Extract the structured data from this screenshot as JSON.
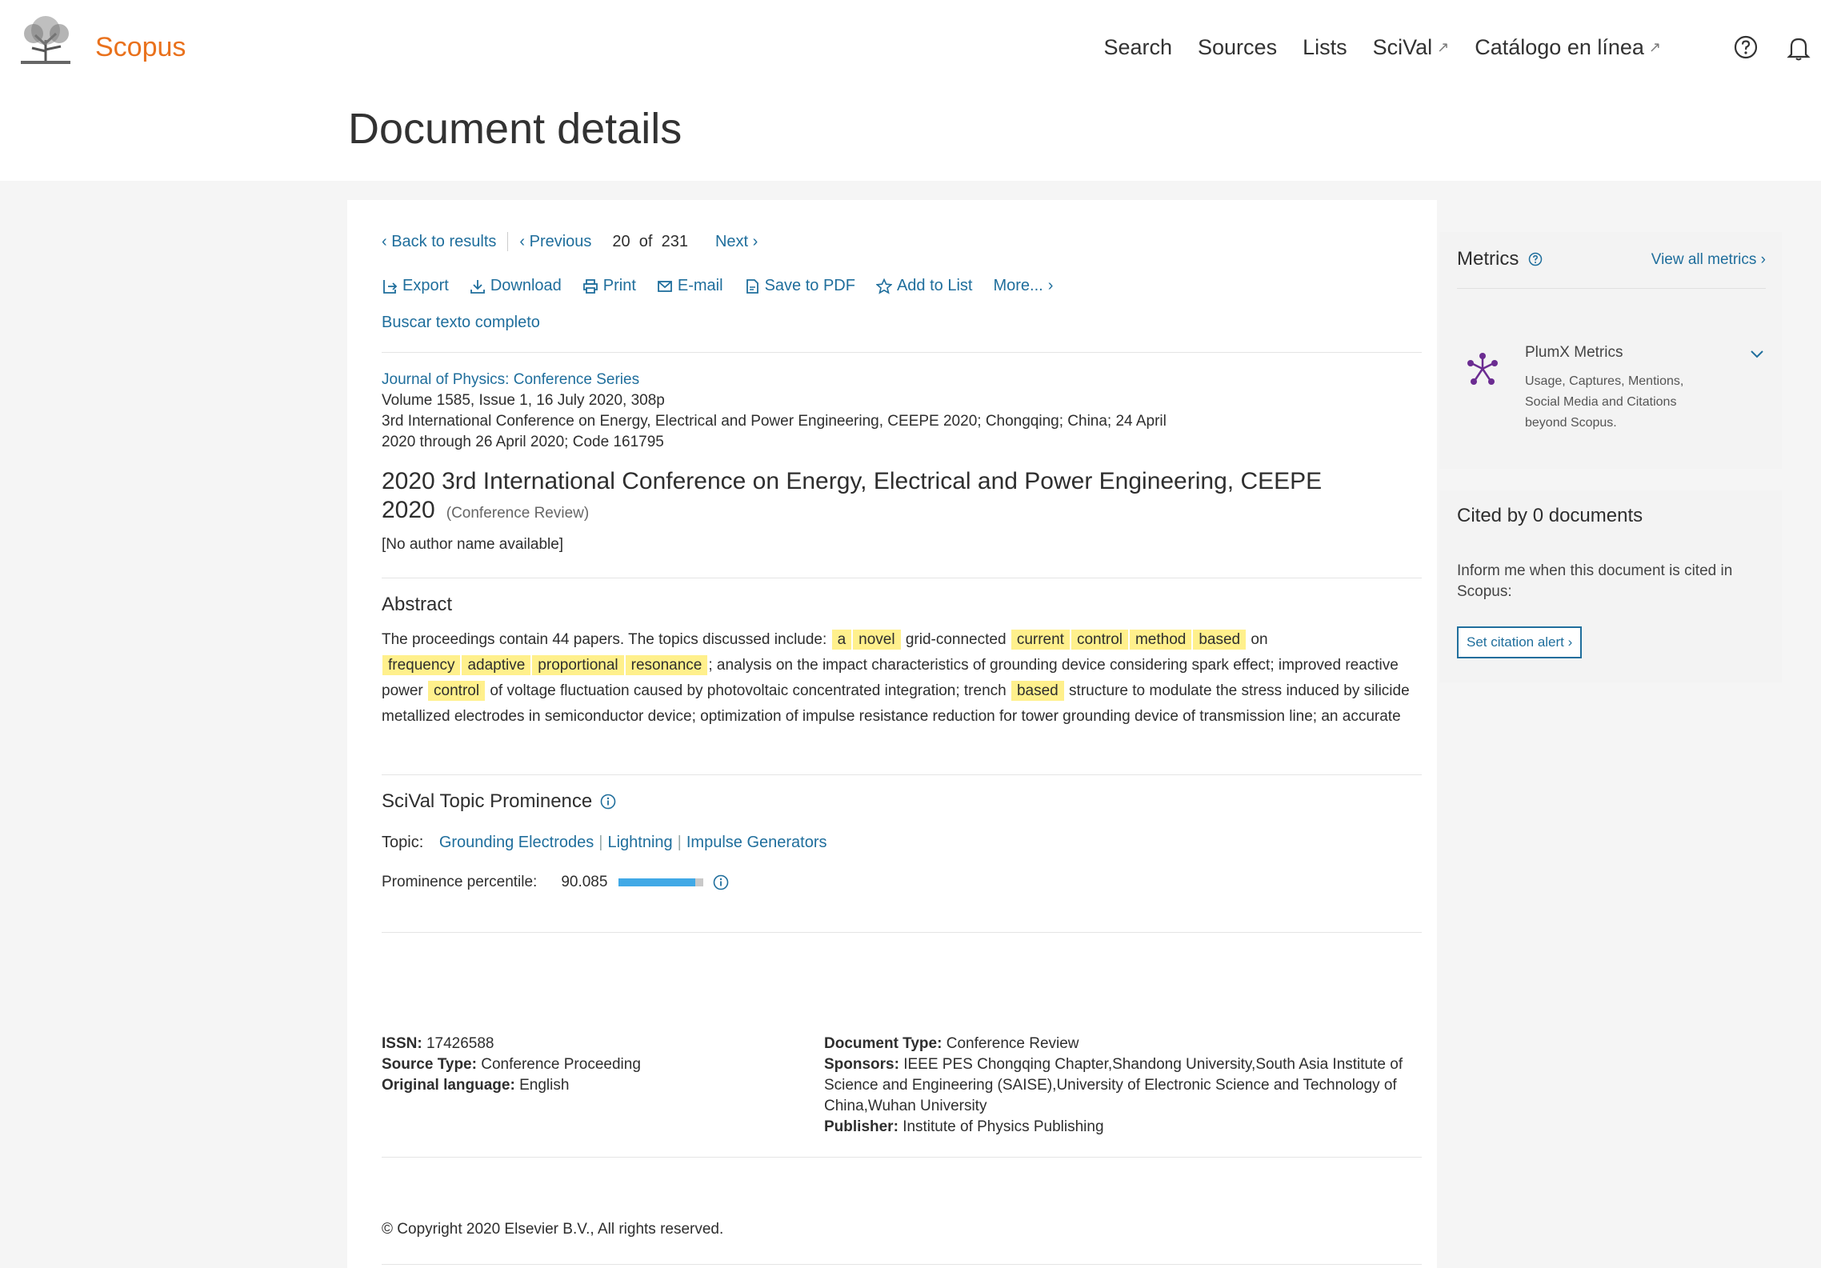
{
  "header": {
    "brand": "Scopus",
    "nav": [
      {
        "label": "Search",
        "ext": ""
      },
      {
        "label": "Sources",
        "ext": ""
      },
      {
        "label": "Lists",
        "ext": ""
      },
      {
        "label": "SciVal",
        "ext": "↗"
      },
      {
        "label": "Catálogo en línea",
        "ext": "↗"
      }
    ],
    "icons": [
      "help-icon",
      "bell-icon"
    ],
    "page_title": "Document details"
  },
  "nav": {
    "back": "Back to results",
    "previous": "Previous",
    "current": "20",
    "of": "of",
    "total": "231",
    "next": "Next"
  },
  "actions": {
    "export": "Export",
    "download": "Download",
    "print": "Print",
    "email": "E-mail",
    "save_pdf": "Save to PDF",
    "add_list": "Add to List",
    "more": "More...",
    "full_text": "Buscar texto completo"
  },
  "document": {
    "journal": "Journal of Physics: Conference Series",
    "volume": "Volume 1585, Issue 1, 16 July 2020, 308p",
    "conference_line1": "3rd International Conference on Energy, Electrical and Power Engineering, CEEPE 2020; Chongqing; China; 24 April",
    "conference_line2": "2020 through 26 April 2020; Code 161795",
    "title": "2020 3rd International Conference on Energy, Electrical and Power Engineering, CEEPE 2020",
    "doc_type": "(Conference Review)",
    "authors": "[No author name available]"
  },
  "abstract": {
    "heading": "Abstract",
    "t1": "The proceedings contain 44 papers. The topics discussed include: ",
    "h1": "a",
    "h2": "novel",
    "t2": " grid-connected ",
    "h3": "current",
    "h4": "control",
    "h5": "method",
    "h6": "based",
    "t3": " on ",
    "h7": "frequency",
    "h8": "adaptive",
    "h9": "proportional",
    "h10": "resonance",
    "t4": "; analysis on the impact characteristics of grounding device considering spark effect; improved reactive power ",
    "h11": "control",
    "t5": " of voltage fluctuation caused by photovoltaic concentrated integration; trench ",
    "h12": "based",
    "t6": " structure to modulate the stress induced by silicide metallized electrodes in semiconductor device; optimization of impulse resistance reduction for tower grounding device of transmission line; an accurate"
  },
  "scival": {
    "heading": "SciVal Topic Prominence",
    "topic_label": "Topic:",
    "topics": [
      "Grounding Electrodes",
      "Lightning",
      "Impulse Generators"
    ],
    "percentile_label": "Prominence percentile:",
    "percentile": "90.085",
    "percentile_fraction": 0.90085
  },
  "details": {
    "issn_label": "ISSN:",
    "issn": "17426588",
    "source_type_label": "Source Type:",
    "source_type": "Conference Proceeding",
    "language_label": "Original language:",
    "language": "English",
    "doc_type_label": "Document Type:",
    "doc_type": "Conference Review",
    "sponsors_label": "Sponsors:",
    "sponsors": "IEEE PES Chongqing Chapter,Shandong University,South Asia Institute of Science and Engineering (SAISE),University of Electronic Science and Technology of China,Wuhan University",
    "publisher_label": "Publisher:",
    "publisher": "Institute of Physics Publishing"
  },
  "copyright": "© Copyright 2020 Elsevier B.V., All rights reserved.",
  "metrics": {
    "heading": "Metrics",
    "view_all": "View all metrics",
    "plumx_title": "PlumX Metrics",
    "plumx_desc": "Usage, Captures, Mentions, Social Media and Citations beyond Scopus."
  },
  "cited": {
    "heading": "Cited by 0 documents",
    "text": "Inform me when this document is cited in Scopus:",
    "button": "Set citation alert"
  },
  "colors": {
    "brand": "#e9711c",
    "link": "#1f6e9c",
    "highlight": "#fff08c",
    "percentile_bar": "#41a9e6"
  }
}
